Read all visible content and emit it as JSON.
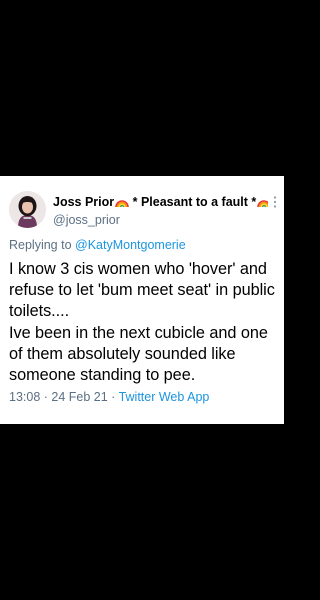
{
  "tweet": {
    "display_name_part1": "Joss Prior",
    "display_name_part2": " * Pleasant to a fault *",
    "handle": "@joss_prior",
    "reply_prefix": "Replying to ",
    "reply_mention": "@KatyMontgomerie",
    "text": "I know 3 cis women who 'hover' and refuse to let 'bum meet seat' in public toilets....\nIve been in the next cubicle and one of them absolutely sounded like someone standing to pee.",
    "time": "13:08",
    "separator": " · ",
    "date": "24 Feb 21",
    "source": "Twitter Web App"
  },
  "colors": {
    "background": "#000000",
    "card": "#ffffff",
    "secondary_text": "#5b7083",
    "link": "#1b95e0"
  },
  "icons": {
    "name_emoji": "rainbow-emoji",
    "menu": "more-vertical-icon"
  }
}
